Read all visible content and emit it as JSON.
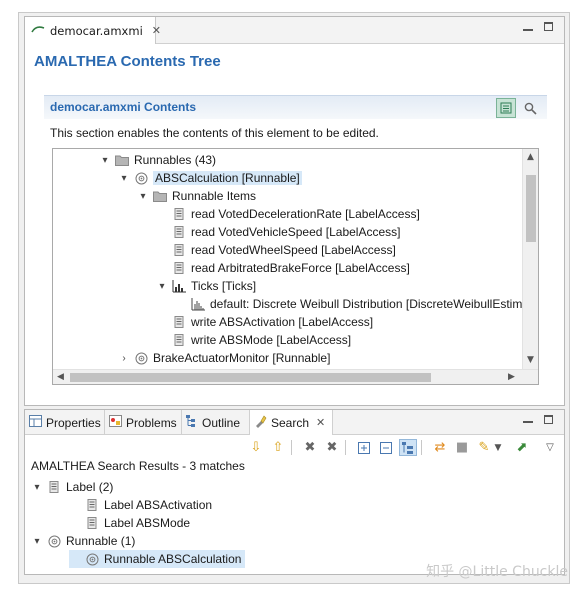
{
  "editor": {
    "tab_label": "democar.amxmi",
    "heading": "AMALTHEA Contents Tree",
    "section_title": "democar.amxmi Contents",
    "section_desc": "This section enables the contents of this element to be edited."
  },
  "tree": [
    {
      "label": "Runnables (43)",
      "indent": 2,
      "toggle": "▾",
      "icon": "folder-icon"
    },
    {
      "label": "ABSCalculation [Runnable]",
      "indent": 3,
      "toggle": "▾",
      "icon": "runnable-icon",
      "selected": true
    },
    {
      "label": "Runnable Items",
      "indent": 4,
      "toggle": "▾",
      "icon": "folder-icon"
    },
    {
      "label": "read VotedDecelerationRate [LabelAccess]",
      "indent": 5,
      "toggle": "",
      "icon": "label-access-icon"
    },
    {
      "label": "read VotedVehicleSpeed [LabelAccess]",
      "indent": 5,
      "toggle": "",
      "icon": "label-access-icon"
    },
    {
      "label": "read VotedWheelSpeed [LabelAccess]",
      "indent": 5,
      "toggle": "",
      "icon": "label-access-icon"
    },
    {
      "label": "read ArbitratedBrakeForce [LabelAccess]",
      "indent": 5,
      "toggle": "",
      "icon": "label-access-icon"
    },
    {
      "label": "Ticks [Ticks]",
      "indent": 5,
      "toggle": "▾",
      "icon": "ticks-icon"
    },
    {
      "label": "default: Discrete Weibull Distribution [DiscreteWeibullEstim",
      "indent": 6,
      "toggle": "",
      "icon": "distribution-icon"
    },
    {
      "label": "write ABSActivation [LabelAccess]",
      "indent": 5,
      "toggle": "",
      "icon": "label-access-icon"
    },
    {
      "label": "write ABSMode [LabelAccess]",
      "indent": 5,
      "toggle": "",
      "icon": "label-access-icon"
    },
    {
      "label": "BrakeActuatorMonitor [Runnable]",
      "indent": 3,
      "toggle": "›",
      "icon": "runnable-icon"
    }
  ],
  "panel": {
    "tabs": [
      "Properties",
      "Problems",
      "Outline",
      "Search"
    ],
    "results_label": "AMALTHEA Search Results - 3 matches",
    "results": [
      {
        "label": "Label (2)",
        "indent": 0,
        "toggle": "▾",
        "icon": "label-access-icon"
      },
      {
        "label": "Label ABSActivation",
        "indent": 1,
        "toggle": "",
        "icon": "label-access-icon"
      },
      {
        "label": "Label ABSMode",
        "indent": 1,
        "toggle": "",
        "icon": "label-access-icon"
      },
      {
        "label": "Runnable (1)",
        "indent": 0,
        "toggle": "▾",
        "icon": "runnable-icon"
      },
      {
        "label": "Runnable ABSCalculation",
        "indent": 1,
        "toggle": "",
        "icon": "runnable-icon",
        "selected": true
      }
    ]
  },
  "watermark": "知乎 @Little Chuckle"
}
